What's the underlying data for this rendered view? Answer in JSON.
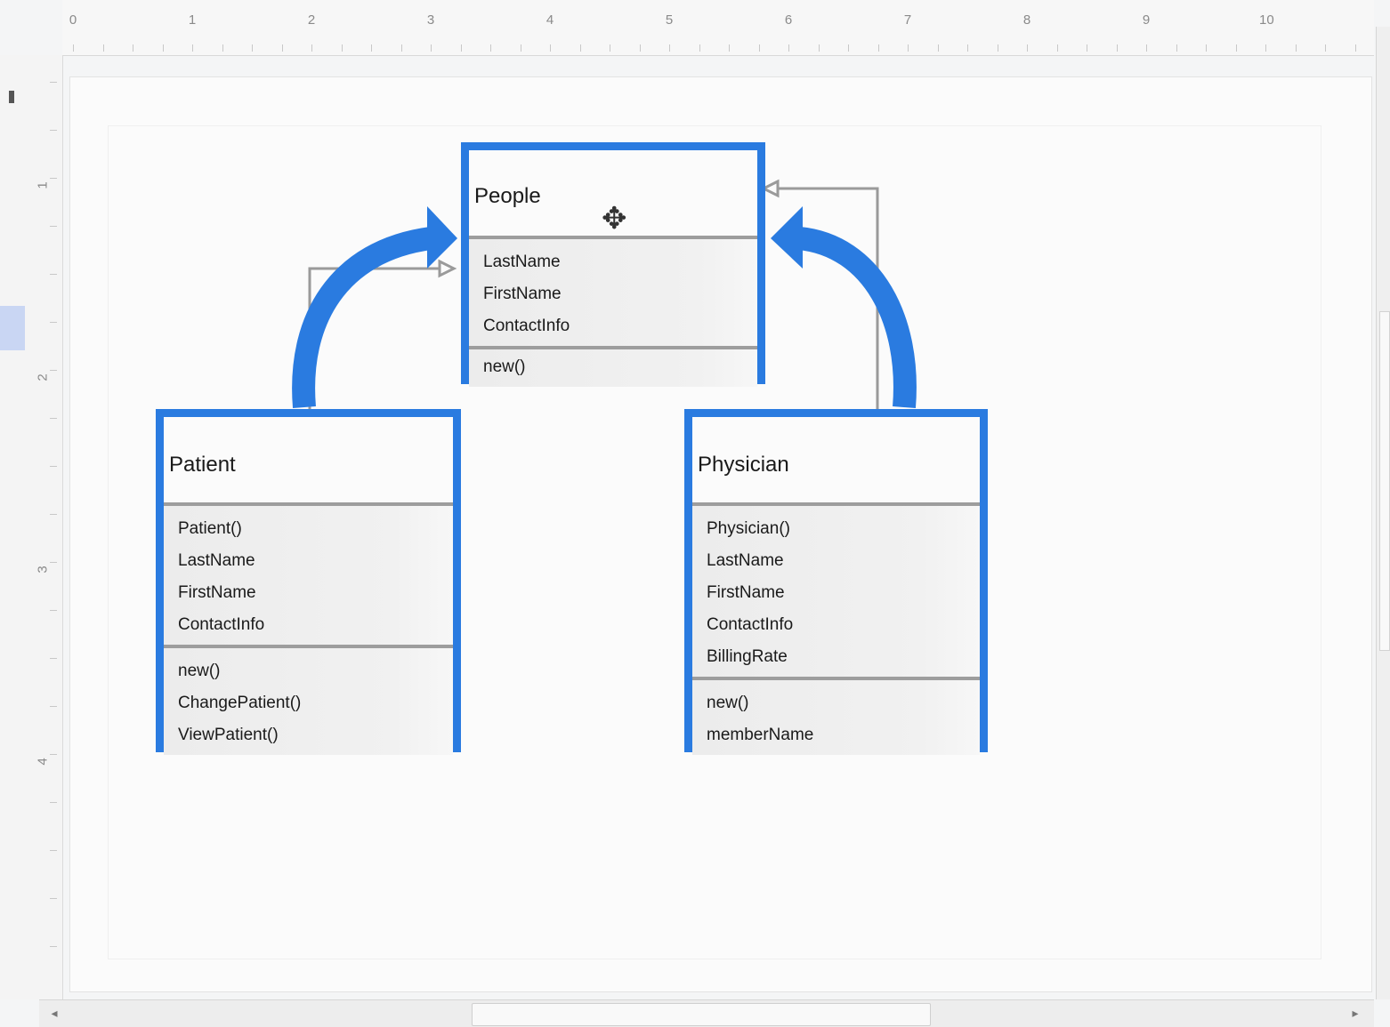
{
  "ruler": {
    "top_labels": [
      "0",
      "1",
      "2",
      "3",
      "4",
      "5",
      "6",
      "7",
      "8",
      "9",
      "10"
    ],
    "left_labels": [
      "1",
      "2",
      "3",
      "4"
    ]
  },
  "diagram": {
    "classes": [
      {
        "id": "people",
        "name": "People",
        "attributes": [
          "LastName",
          "FirstName",
          "ContactInfo"
        ],
        "operations": [
          "new()"
        ]
      },
      {
        "id": "patient",
        "name": "Patient",
        "attributes": [
          "Patient()",
          "LastName",
          "FirstName",
          "ContactInfo"
        ],
        "operations": [
          "new()",
          "ChangePatient()",
          "ViewPatient()"
        ]
      },
      {
        "id": "physician",
        "name": "Physician",
        "attributes": [
          "Physician()",
          "LastName",
          "FirstName",
          "ContactInfo",
          "BillingRate"
        ],
        "operations": [
          "new()",
          "memberName"
        ]
      }
    ],
    "relations": [
      {
        "from": "patient",
        "to": "people",
        "type": "inheritance"
      },
      {
        "from": "physician",
        "to": "people",
        "type": "inheritance"
      }
    ],
    "highlight_color": "#2a7be0",
    "connector_color": "#9a9a9a"
  },
  "icons": {
    "cursor": "move-cursor-icon",
    "scroll_left": "scroll-left-icon",
    "scroll_right": "scroll-right-icon"
  }
}
